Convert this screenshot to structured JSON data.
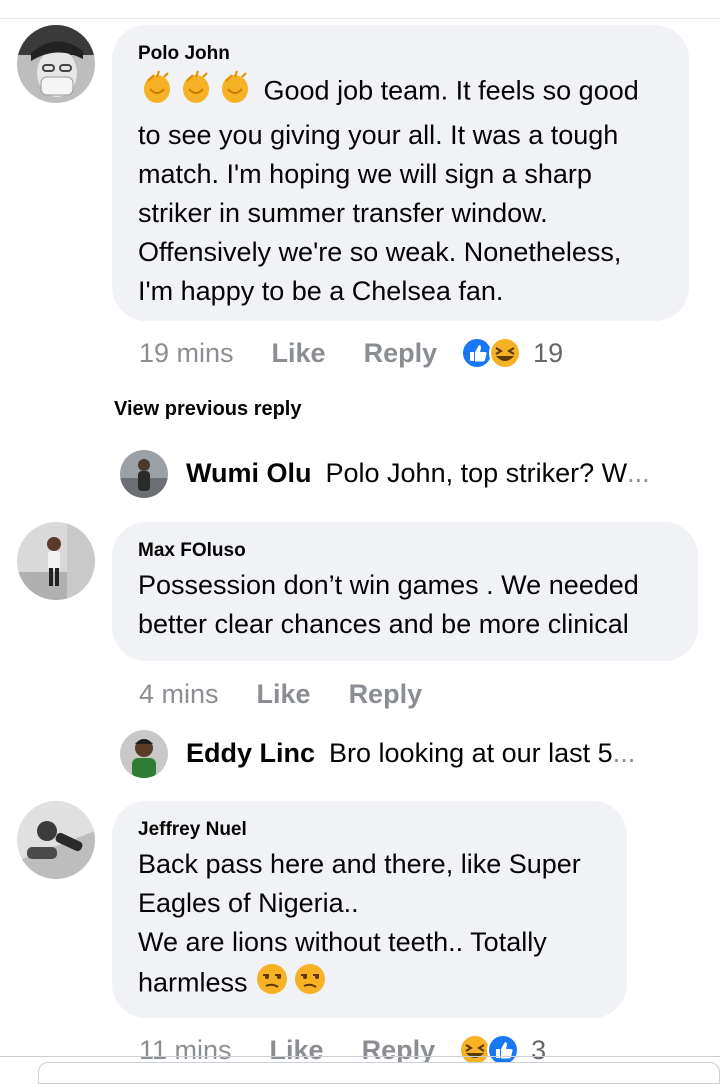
{
  "comments": [
    {
      "author": "Polo John",
      "lead_emojis": [
        "clapping-hands",
        "clapping-hands",
        "clapping-hands"
      ],
      "lines": [
        "Good job team. It feels so good",
        "to see you giving your all. It was a tough",
        "match. I'm hoping we will sign a sharp",
        "striker in summer transfer window.",
        "Offensively we're so weak. Nonetheless,",
        "I'm happy to be a Chelsea fan."
      ],
      "time": "19 mins",
      "like": "Like",
      "reply": "Reply",
      "reaction_count": "19",
      "reactions": [
        "like-reaction",
        "haha-reaction"
      ]
    },
    {
      "author": "Max FOluso",
      "lines": [
        "Possession don’t win games . We needed",
        "better clear chances and be more clinical"
      ],
      "time": "4 mins",
      "like": "Like",
      "reply": "Reply"
    },
    {
      "author": "Jeffrey Nuel",
      "lines": [
        "Back pass here and there, like Super",
        "Eagles of Nigeria..",
        "We are lions without teeth.. Totally",
        "harmless"
      ],
      "trail_emojis": [
        "unamused-face",
        "unamused-face"
      ],
      "time": "11 mins",
      "like": "Like",
      "reply": "Reply",
      "reaction_count": "3",
      "reactions": [
        "haha-reaction",
        "like-reaction"
      ]
    }
  ],
  "view_previous": "View previous reply",
  "replies": [
    {
      "author": "Wumi Olu",
      "text": "Polo John, top striker? W",
      "ellipsis": "..."
    },
    {
      "author": "Eddy Linc",
      "text": "Bro looking at our last 5",
      "ellipsis": " ..."
    }
  ],
  "colors": {
    "bubble": "#f0f2f5",
    "meta": "#8a8d91",
    "like_blue": "#1877f2",
    "haha_yellow": "#f7b125"
  }
}
